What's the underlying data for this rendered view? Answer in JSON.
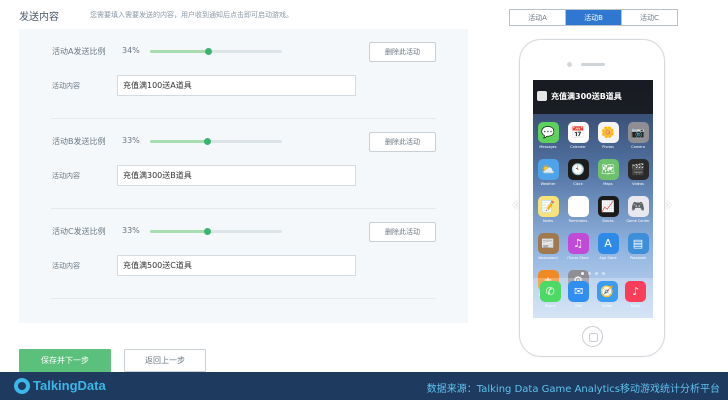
{
  "header": {
    "title": "发送内容",
    "hint": "您需要填入需要发送的内容，用户收到通知后点击即可启动游戏。"
  },
  "activities": [
    {
      "ratio_label": "活动A发送比例",
      "ratio_text": "34%",
      "ratio": 0.34,
      "delete_label": "删除此活动",
      "content_label": "活动内容",
      "content_value": "充值满100送A道具"
    },
    {
      "ratio_label": "活动B发送比例",
      "ratio_text": "33%",
      "ratio": 0.33,
      "delete_label": "删除此活动",
      "content_label": "活动内容",
      "content_value": "充值满300送B道具"
    },
    {
      "ratio_label": "活动C发送比例",
      "ratio_text": "33%",
      "ratio": 0.33,
      "delete_label": "删除此活动",
      "content_label": "活动内容",
      "content_value": "充值满500送C道具"
    }
  ],
  "actions": {
    "save_next": "保存并下一步",
    "back": "返回上一步"
  },
  "preview": {
    "tabs": [
      "活动A",
      "活动B",
      "活动C"
    ],
    "active_tab": 1,
    "notification_text": "充值满300送B道具",
    "apps": [
      {
        "label": "Messages",
        "icon": "messages-icon",
        "color": "#5dd15b",
        "glyph": "💬"
      },
      {
        "label": "Calendar",
        "icon": "calendar-icon",
        "color": "#ffffff",
        "glyph": "📅"
      },
      {
        "label": "Photos",
        "icon": "photos-icon",
        "color": "#f5f5f5",
        "glyph": "🌼"
      },
      {
        "label": "Camera",
        "icon": "camera-icon",
        "color": "#8e8e93",
        "glyph": "📷"
      },
      {
        "label": "Weather",
        "icon": "weather-icon",
        "color": "#4fa3e8",
        "glyph": "⛅"
      },
      {
        "label": "Clock",
        "icon": "clock-icon",
        "color": "#1c1c1c",
        "glyph": "🕙"
      },
      {
        "label": "Maps",
        "icon": "maps-icon",
        "color": "#6ec16c",
        "glyph": "🗺"
      },
      {
        "label": "Videos",
        "icon": "videos-icon",
        "color": "#2a2a2a",
        "glyph": "🎬"
      },
      {
        "label": "Notes",
        "icon": "notes-icon",
        "color": "#f8e27a",
        "glyph": "📝"
      },
      {
        "label": "Reminders",
        "icon": "reminders-icon",
        "color": "#ffffff",
        "glyph": "☰"
      },
      {
        "label": "Stocks",
        "icon": "stocks-icon",
        "color": "#1a1a1a",
        "glyph": "📈"
      },
      {
        "label": "Game Center",
        "icon": "game-center-icon",
        "color": "#e8e8ee",
        "glyph": "🎮"
      },
      {
        "label": "Newsstand",
        "icon": "newsstand-icon",
        "color": "#a07a4c",
        "glyph": "📰"
      },
      {
        "label": "iTunes Store",
        "icon": "itunes-icon",
        "color": "#c14ad6",
        "glyph": "♫"
      },
      {
        "label": "App Store",
        "icon": "app-store-icon",
        "color": "#2e8ae6",
        "glyph": "A"
      },
      {
        "label": "Passbook",
        "icon": "passbook-icon",
        "color": "#3d8fd9",
        "glyph": "▤"
      },
      {
        "label": "Calculator",
        "icon": "calculator-icon",
        "color": "#f08a24",
        "glyph": "±"
      },
      {
        "label": "Settings",
        "icon": "settings-icon",
        "color": "#8e8e93",
        "glyph": "⚙"
      }
    ],
    "dock": [
      {
        "label": "Phone",
        "icon": "phone-icon",
        "color": "#4cd964",
        "glyph": "✆"
      },
      {
        "label": "Mail",
        "icon": "mail-icon",
        "color": "#2f8ef0",
        "glyph": "✉"
      },
      {
        "label": "Safari",
        "icon": "safari-icon",
        "color": "#3a9bf0",
        "glyph": "🧭"
      },
      {
        "label": "Music",
        "icon": "music-icon",
        "color": "#fc3d5a",
        "glyph": "♪"
      }
    ]
  },
  "footer": {
    "logo_text": "TalkingData",
    "source_text": "数据来源：Talking Data Game Analytics移动游戏统计分析平台"
  }
}
